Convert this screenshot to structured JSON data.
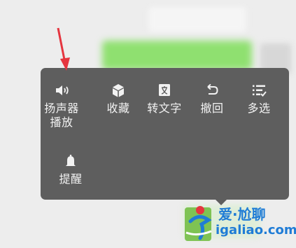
{
  "menu": {
    "items": [
      {
        "label": "扬声器\n播放",
        "icon": "speaker-icon"
      },
      {
        "label": "收藏",
        "icon": "favorite-cube-icon"
      },
      {
        "label": "转文字",
        "icon": "text-convert-icon"
      },
      {
        "label": "撤回",
        "icon": "undo-icon"
      },
      {
        "label": "多选",
        "icon": "multi-select-icon"
      },
      {
        "label": "提醒",
        "icon": "bell-icon"
      }
    ]
  },
  "watermark": {
    "title": "爱·尬聊",
    "url": "igaliao.com"
  },
  "colors": {
    "menu_bg": "#5e5e5e",
    "menu_text": "#f2f2f2",
    "arrow": "#e5353f",
    "watermark": "#1f7cd6"
  }
}
